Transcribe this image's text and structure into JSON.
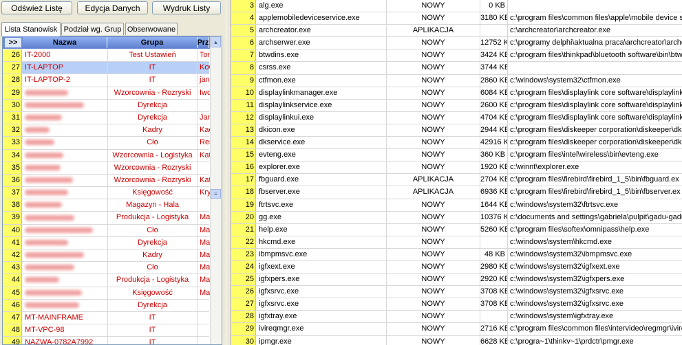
{
  "toolbar": {
    "refresh_label": "Odśwież Listę",
    "edit_label": "Edycja Danych",
    "print_label": "Wydruk Listy"
  },
  "tabs": [
    {
      "label": "Lista Stanowisk"
    },
    {
      "label": "Podział wg. Grup"
    },
    {
      "label": "Obserwowane"
    }
  ],
  "left_table": {
    "expand_label": ">>",
    "headers": {
      "name": "Nazwa",
      "group": "Grupa",
      "prz": "Prz"
    },
    "rows": [
      {
        "num": "26",
        "name": "IT-2000",
        "group": "Test Ustawień",
        "prz": "Tom"
      },
      {
        "num": "27",
        "name": "IT-LAPTOP",
        "group": "IT",
        "prz": "Kow"
      },
      {
        "num": "28",
        "name": "IT-LAPTOP-2",
        "group": "IT",
        "prz": "jan"
      },
      {
        "num": "29",
        "name": "",
        "group": "Wzorcownia - Rozryski",
        "prz": "Iwo"
      },
      {
        "num": "30",
        "name": "",
        "group": "Dyrekcja",
        "prz": ""
      },
      {
        "num": "31",
        "name": "",
        "group": "Dyrekcja",
        "prz": "Jan"
      },
      {
        "num": "32",
        "name": "",
        "group": "Kadry",
        "prz": "Kac"
      },
      {
        "num": "33",
        "name": "",
        "group": "Cło",
        "prz": "Ren"
      },
      {
        "num": "34",
        "name": "",
        "group": "Wzorcownia - Logistyka",
        "prz": "Kat"
      },
      {
        "num": "35",
        "name": "",
        "group": "Wzorcownia - Rozryski",
        "prz": ""
      },
      {
        "num": "36",
        "name": "",
        "group": "Wzorcownia - Rozryski",
        "prz": "Kat"
      },
      {
        "num": "37",
        "name": "",
        "group": "Księgowość",
        "prz": "Krys"
      },
      {
        "num": "38",
        "name": "",
        "group": "Magazyn - Hala",
        "prz": ""
      },
      {
        "num": "39",
        "name": "",
        "group": "Produkcja - Logistyka",
        "prz": "Mag"
      },
      {
        "num": "40",
        "name": "",
        "group": "Cło",
        "prz": "Mag"
      },
      {
        "num": "41",
        "name": "",
        "group": "Dyrekcja",
        "prz": "Mar"
      },
      {
        "num": "42",
        "name": "",
        "group": "Kadry",
        "prz": "Mar"
      },
      {
        "num": "43",
        "name": "",
        "group": "Cło",
        "prz": "Mar"
      },
      {
        "num": "44",
        "name": "",
        "group": "Produkcja - Logistyka",
        "prz": "Mał"
      },
      {
        "num": "45",
        "name": "",
        "group": "Księgowość",
        "prz": "Mar"
      },
      {
        "num": "46",
        "name": "",
        "group": "Dyrekcja",
        "prz": ""
      },
      {
        "num": "47",
        "name": "MT-MAINFRAME",
        "group": "IT",
        "prz": ""
      },
      {
        "num": "48",
        "name": "MT-VPC-98",
        "group": "IT",
        "prz": ""
      },
      {
        "num": "49",
        "name": "NAZWA-0782A7992",
        "group": "IT",
        "prz": ""
      }
    ]
  },
  "right_table": {
    "rows": [
      {
        "num": "3",
        "exe": "alg.exe",
        "status": "NOWY",
        "size": "0 KB",
        "path": ""
      },
      {
        "num": "4",
        "exe": "applemobiledeviceservice.exe",
        "status": "NOWY",
        "size": "3180 KB",
        "path": "c:\\program files\\common files\\apple\\mobile device su"
      },
      {
        "num": "5",
        "exe": "archcreator.exe",
        "status": "APLIKACJA",
        "size": "",
        "path": "c:\\archcreator\\archcreator.exe"
      },
      {
        "num": "6",
        "exe": "archserwer.exe",
        "status": "NOWY",
        "size": "12752 KB",
        "path": "c:\\programy delphi\\aktualna praca\\archcreator\\archc"
      },
      {
        "num": "7",
        "exe": "btwdins.exe",
        "status": "NOWY",
        "size": "3424 KB",
        "path": "c:\\program files\\thinkpad\\bluetooth software\\bin\\btw"
      },
      {
        "num": "8",
        "exe": "csrss.exe",
        "status": "NOWY",
        "size": "3744 KB",
        "path": ""
      },
      {
        "num": "9",
        "exe": "ctfmon.exe",
        "status": "NOWY",
        "size": "2860 KB",
        "path": "c:\\windows\\system32\\ctfmon.exe"
      },
      {
        "num": "10",
        "exe": "displaylinkmanager.exe",
        "status": "NOWY",
        "size": "6084 KB",
        "path": "c:\\program files\\displaylink core software\\displaylinkn"
      },
      {
        "num": "11",
        "exe": "displaylinkservice.exe",
        "status": "NOWY",
        "size": "2600 KB",
        "path": "c:\\program files\\displaylink core software\\displaylinks"
      },
      {
        "num": "12",
        "exe": "displaylinkui.exe",
        "status": "NOWY",
        "size": "4704 KB",
        "path": "c:\\program files\\displaylink core software\\displaylinku"
      },
      {
        "num": "13",
        "exe": "dkicon.exe",
        "status": "NOWY",
        "size": "2944 KB",
        "path": "c:\\program files\\diskeeper corporation\\diskeeper\\dki"
      },
      {
        "num": "14",
        "exe": "dkservice.exe",
        "status": "NOWY",
        "size": "42916 KB",
        "path": "c:\\program files\\diskeeper corporation\\diskeeper\\dks"
      },
      {
        "num": "15",
        "exe": "evteng.exe",
        "status": "NOWY",
        "size": "360 KB",
        "path": "c:\\program files\\intel\\wireless\\bin\\evteng.exe"
      },
      {
        "num": "16",
        "exe": "explorer.exe",
        "status": "NOWY",
        "size": "1920 KB",
        "path": "c:\\winnt\\explorer.exe"
      },
      {
        "num": "17",
        "exe": "fbguard.exe",
        "status": "APLIKACJA",
        "size": "2704 KB",
        "path": "c:\\program files\\firebird\\firebird_1_5\\bin\\fbguard.ex"
      },
      {
        "num": "18",
        "exe": "fbserver.exe",
        "status": "APLIKACJA",
        "size": "6936 KB",
        "path": "c:\\program files\\firebird\\firebird_1_5\\bin\\fbserver.ex"
      },
      {
        "num": "19",
        "exe": "ftrtsvc.exe",
        "status": "NOWY",
        "size": "1644 KB",
        "path": "c:\\windows\\system32\\ftrtsvc.exe"
      },
      {
        "num": "20",
        "exe": "gg.exe",
        "status": "NOWY",
        "size": "10376 KB",
        "path": "c:\\documents and settings\\gabriela\\pulpit\\gadu-gadu"
      },
      {
        "num": "21",
        "exe": "help.exe",
        "status": "NOWY",
        "size": "5260 KB",
        "path": "c:\\program files\\softex\\omnipass\\help.exe"
      },
      {
        "num": "22",
        "exe": "hkcmd.exe",
        "status": "NOWY",
        "size": "",
        "path": "c:\\windows\\system\\hkcmd.exe"
      },
      {
        "num": "23",
        "exe": "ibmpmsvc.exe",
        "status": "NOWY",
        "size": "48 KB",
        "path": "c:\\windows\\system32\\ibmpmsvc.exe"
      },
      {
        "num": "24",
        "exe": "igfxext.exe",
        "status": "NOWY",
        "size": "2980 KB",
        "path": "c:\\windows\\system32\\igfxext.exe"
      },
      {
        "num": "25",
        "exe": "igfxpers.exe",
        "status": "NOWY",
        "size": "2920 KB",
        "path": "c:\\windows\\system32\\igfxpers.exe"
      },
      {
        "num": "26",
        "exe": "igfxsrvc.exe",
        "status": "NOWY",
        "size": "3708 KB",
        "path": "c:\\windows\\system32\\igfxsrvc.exe"
      },
      {
        "num": "27",
        "exe": "igfxsrvc.exe",
        "status": "NOWY",
        "size": "3708 KB",
        "path": "c:\\windows\\system32\\igfxsrvc.exe"
      },
      {
        "num": "28",
        "exe": "igfxtray.exe",
        "status": "NOWY",
        "size": "",
        "path": "c:\\windows\\system\\igfxtray.exe"
      },
      {
        "num": "29",
        "exe": "ivireqmgr.exe",
        "status": "NOWY",
        "size": "2716 KB",
        "path": "c:\\program files\\common files\\intervideo\\regmgr\\ivireg"
      },
      {
        "num": "30",
        "exe": "ipmgr.exe",
        "status": "NOWY",
        "size": "6628 KB",
        "path": "c:\\progra~1\\thinkv~1\\prdctr\\pmgr.exe"
      }
    ]
  }
}
